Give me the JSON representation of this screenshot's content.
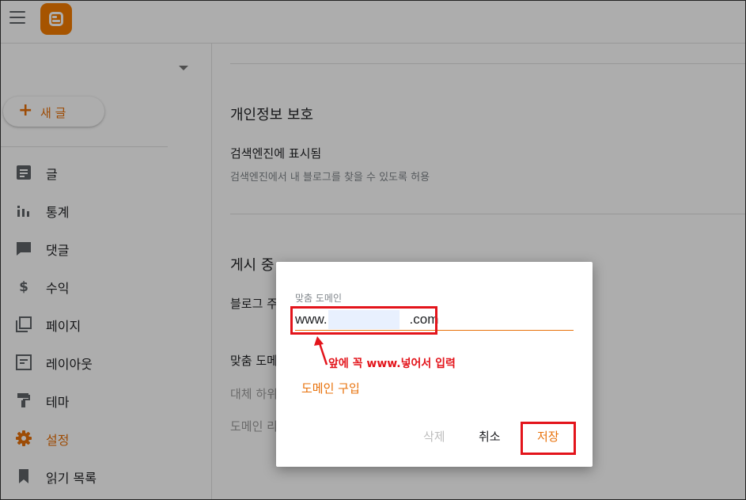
{
  "colors": {
    "accent": "#e8710a",
    "annotation_red": "#e3141b",
    "logo_orange": "#f57d00"
  },
  "header": {
    "menu_icon": "hamburger-icon",
    "logo_icon": "blogger-logo-icon"
  },
  "sidebar": {
    "new_post_label": "새 글",
    "items": [
      {
        "label": "글",
        "icon": "posts-icon"
      },
      {
        "label": "통계",
        "icon": "stats-icon"
      },
      {
        "label": "댓글",
        "icon": "comments-icon"
      },
      {
        "label": "수익",
        "icon": "earnings-icon"
      },
      {
        "label": "페이지",
        "icon": "pages-icon"
      },
      {
        "label": "레이아웃",
        "icon": "layout-icon"
      },
      {
        "label": "테마",
        "icon": "theme-icon"
      },
      {
        "label": "설정",
        "icon": "settings-icon",
        "active": true
      },
      {
        "label": "읽기 목록",
        "icon": "reading-list-icon"
      }
    ]
  },
  "main": {
    "privacy_title": "개인정보 보호",
    "search_visible_title": "검색엔진에 표시됨",
    "search_visible_desc": "검색엔진에서 내 블로그를 찾을 수 있도록 허용",
    "publishing_title": "게시 중",
    "blog_address_title": "블로그 주",
    "custom_domain_title": "맞춤 도메",
    "fallback_desc": "대체 하위",
    "domain_desc": "도메인 리"
  },
  "dialog": {
    "field_label": "맞춤 도메인",
    "field_value": "www.                      .com",
    "annotation": "앞에 꼭 www.넣어서 입력",
    "buy_domain_link": "도메인 구입",
    "delete_label": "삭제",
    "cancel_label": "취소",
    "save_label": "저장"
  }
}
